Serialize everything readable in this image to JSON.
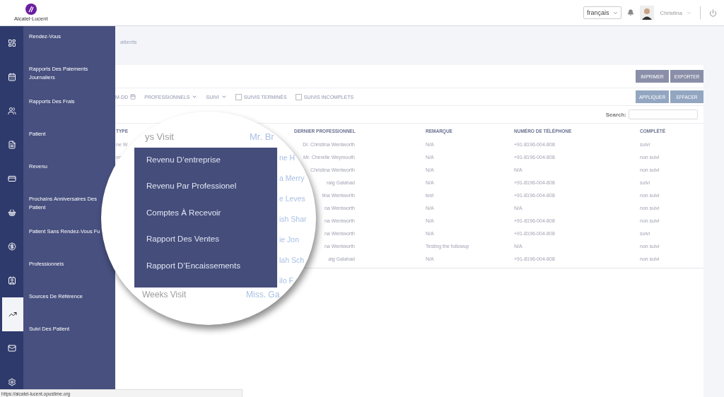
{
  "logo": {
    "text": "Alcatel·Lucent"
  },
  "header": {
    "language": "français",
    "user": "Christina"
  },
  "rail": [
    {
      "kind": "dashboard",
      "selected": false
    },
    {
      "kind": "calendar",
      "selected": false
    },
    {
      "kind": "people",
      "selected": false
    },
    {
      "kind": "list",
      "selected": false
    },
    {
      "kind": "card",
      "selected": false
    },
    {
      "kind": "basket",
      "selected": false
    },
    {
      "kind": "dollar",
      "selected": false
    },
    {
      "kind": "contact",
      "selected": false
    },
    {
      "kind": "chart",
      "selected": true
    },
    {
      "kind": "mail",
      "selected": false
    },
    {
      "kind": "settings",
      "selected": false
    }
  ],
  "flyout": {
    "items": [
      "Rendez-Vous",
      "Rapports Des Paiements Journaliers",
      "Rapports Des Frais",
      "Patient",
      "Revenu",
      "Prochains Anniversaires Des Patient",
      "Patient Sans Rendez-Vous Fu",
      "Professionnels",
      "Sources De Référence",
      "Suivi Des Patient"
    ]
  },
  "breadcrumb": "atients",
  "toolbar": {
    "buttons": [
      "IMPRIMER",
      "EXPORTER"
    ]
  },
  "filters": {
    "items": [
      {
        "kind": "date",
        "label": "M-DD"
      },
      {
        "kind": "dropdown",
        "label": "PROFESSIONNELS"
      },
      {
        "kind": "dropdown",
        "label": "SUIVI"
      },
      {
        "kind": "checkbox",
        "label": "SUIVIS TERMINÉS",
        "checked": false
      },
      {
        "kind": "checkbox",
        "label": "SUIVIS INCOMPLETS",
        "checked": false
      }
    ],
    "buttons": [
      "APPLIQUER",
      "EFFACER"
    ]
  },
  "search": {
    "label": "Search:"
  },
  "table": {
    "columns": [
      "TYPE",
      "DERNIER PROFESSIONNEL",
      "REMARQUE",
      "NUMÉRO DE TÉLÉPHONE",
      "COMPLÉTÉ"
    ],
    "rows": [
      [
        "ne W",
        "Dr. Christina Wentworth",
        "N/A",
        "+91-8196-004-808",
        "suivi"
      ],
      [
        "en",
        "Mr. Cherelle Weymouth",
        "N/A",
        "+91-8196-004-808",
        "non suivi"
      ],
      [
        "",
        "Christina Wentworth",
        "N/A",
        "N/A",
        "non suivi"
      ],
      [
        "",
        "raig Galahad",
        "N/A",
        "+91-8196-004-808",
        "suivi"
      ],
      [
        "",
        "tina Wentworth",
        "test",
        "+91-8196-004-808",
        "non suivi"
      ],
      [
        "",
        "na Wentworth",
        "N/A",
        "N/A",
        "non suivi"
      ],
      [
        "",
        "na Wentworth",
        "N/A",
        "+91-8196-004-808",
        "non suivi"
      ],
      [
        "",
        "na Wentworth",
        "N/A",
        "+91-8196-004-808",
        "suivi"
      ],
      [
        "",
        "na Wentworth",
        "Testing the followup",
        "N/A",
        "non suivi"
      ],
      [
        "",
        "aig Galahad",
        "N/A",
        "+91-8196-004-808",
        "non suivi"
      ]
    ]
  },
  "magnifier": {
    "top": [
      "ys Visit",
      "Mr. Br"
    ],
    "menu": [
      "Revenu D’entreprise",
      "Revenu Par Professionel",
      "Comptes À Recevoir",
      "Rapport Des Ventes",
      "Rapport D’Encaissements"
    ],
    "side": [
      "ne H",
      "a Merry",
      "e Leves",
      "ish Shar",
      "ie Jon",
      "lah Sch",
      "ilo F"
    ],
    "bottom": [
      "Weeks Visit",
      "Miss. Ga"
    ]
  },
  "status_bar": "https://alcatel-lucent.opustime.org"
}
